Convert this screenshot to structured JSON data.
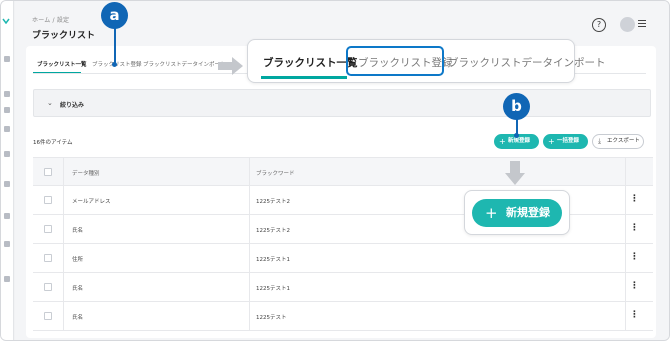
{
  "breadcrumb": "ホーム / 設定",
  "page_title": "ブラックリスト",
  "tabs": [
    {
      "label": "ブラックリスト一覧"
    },
    {
      "label": "ブラックリスト登録"
    },
    {
      "label": "ブラックリストデータインポート"
    }
  ],
  "filter": {
    "label": "絞り込み"
  },
  "item_count": "16件のアイテム",
  "buttons": {
    "new_register": "新規登録",
    "bulk_register": "一括登録",
    "export": "エクスポート"
  },
  "table": {
    "columns": [
      "データ種別",
      "ブラックワード"
    ],
    "rows": [
      [
        "メールアドレス",
        "1225テスト2"
      ],
      [
        "氏名",
        "1225テスト2"
      ],
      [
        "住所",
        "1225テスト1"
      ],
      [
        "氏名",
        "1225テスト1"
      ],
      [
        "氏名",
        "1225テスト"
      ]
    ]
  },
  "callouts": {
    "marker_a": "a",
    "marker_b": "b",
    "tabs": [
      "ブラックリスト一覧",
      "ブラックリスト登録",
      "ブラックリストデータインポート"
    ],
    "button": "新規登録"
  },
  "colors": {
    "accent": "#1eb7b0",
    "marker": "#1066b5",
    "highlight": "#0d78c8"
  }
}
